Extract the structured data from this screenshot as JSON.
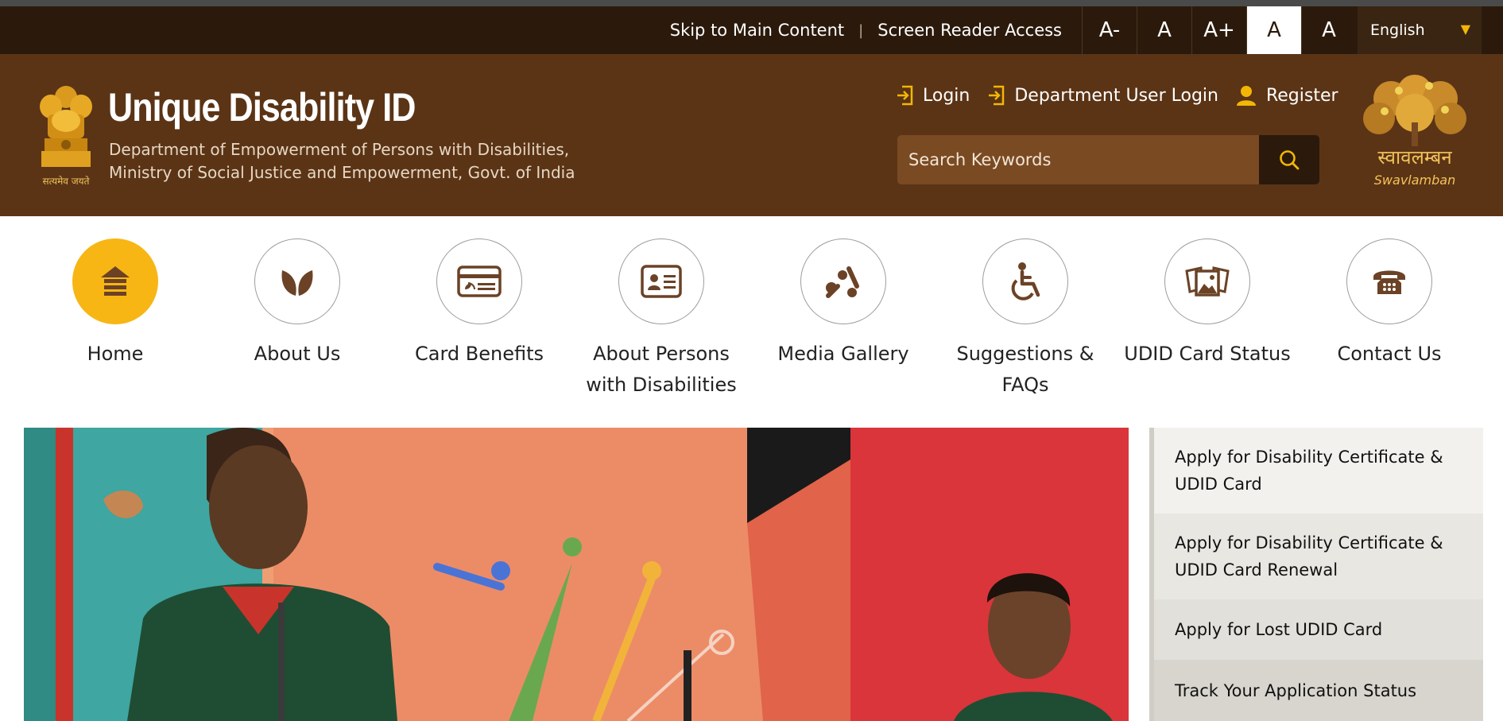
{
  "utility_bar": {
    "skip_link": "Skip to Main Content",
    "separator": "|",
    "screen_reader": "Screen Reader Access",
    "font_buttons": [
      "A-",
      "A",
      "A+",
      "A",
      "A"
    ],
    "language": "English"
  },
  "header": {
    "title": "Unique Disability ID",
    "department_line1": "Department of Empowerment of Persons with Disabilities,",
    "department_line2": "Ministry of Social Justice and Empowerment, Govt. of India",
    "emblem_caption": "सत्यमेव जयते",
    "login": "Login",
    "dept_login": "Department User Login",
    "register": "Register",
    "search_placeholder": "Search Keywords",
    "swavlamban_hindi": "स्वावलम्बन",
    "swavlamban_latin": "Swavlamban"
  },
  "nav": [
    {
      "label": "Home",
      "icon": "home-icon"
    },
    {
      "label": "About Us",
      "icon": "leaf-icon"
    },
    {
      "label": "Card Benefits",
      "icon": "card-icon"
    },
    {
      "label": "About Persons with Disabilities",
      "icon": "id-card-icon"
    },
    {
      "label": "Media Gallery",
      "icon": "media-icon"
    },
    {
      "label": "Suggestions & FAQs",
      "icon": "wheelchair-icon"
    },
    {
      "label": "UDID Card Status",
      "icon": "photos-icon"
    },
    {
      "label": "Contact Us",
      "icon": "telephone-icon"
    }
  ],
  "quick_links": [
    "Apply for Disability Certificate & UDID Card",
    "Apply for Disability Certificate & UDID Card Renewal",
    "Apply for Lost UDID Card",
    "Track Your Application Status"
  ],
  "colors": {
    "utility_bar": "#2b1a0c",
    "header": "#5b3416",
    "accent": "#f7b614",
    "icon_brown": "#6b4226"
  }
}
